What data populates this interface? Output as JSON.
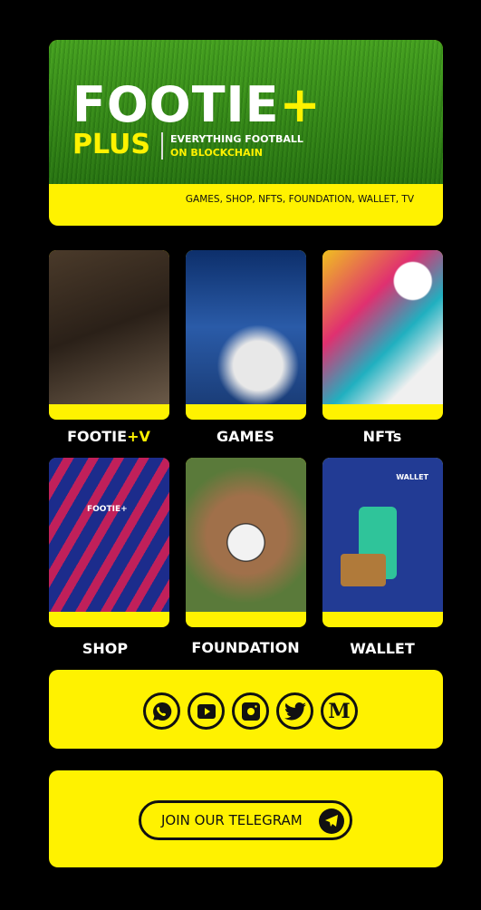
{
  "banner": {
    "logo_word": "FOOTIE",
    "logo_plus_sign": "+",
    "logo_sub": "PLUS",
    "tagline_1": "EVERYTHING FOOTBALL",
    "tagline_2": "ON BLOCKCHAIN",
    "services": "GAMES, SHOP, NFTS, FOUNDATION, WALLET, TV"
  },
  "cards": [
    {
      "label_a": "FOOTIE",
      "label_plus": "+",
      "label_b": "V"
    },
    {
      "label": "GAMES"
    },
    {
      "label": "NFTs"
    },
    {
      "label": "SHOP",
      "jersey_text": "FOOTIE+"
    },
    {
      "label": "FOUNDATION"
    },
    {
      "label": "WALLET",
      "image_text": "WALLET"
    }
  ],
  "social": {
    "icons": [
      "whatsapp-icon",
      "youtube-icon",
      "instagram-icon",
      "twitter-icon",
      "medium-icon"
    ],
    "medium_letter": "M"
  },
  "telegram": {
    "label": "JOIN OUR TELEGRAM"
  },
  "colors": {
    "accent": "#fff200",
    "background": "#000000"
  }
}
